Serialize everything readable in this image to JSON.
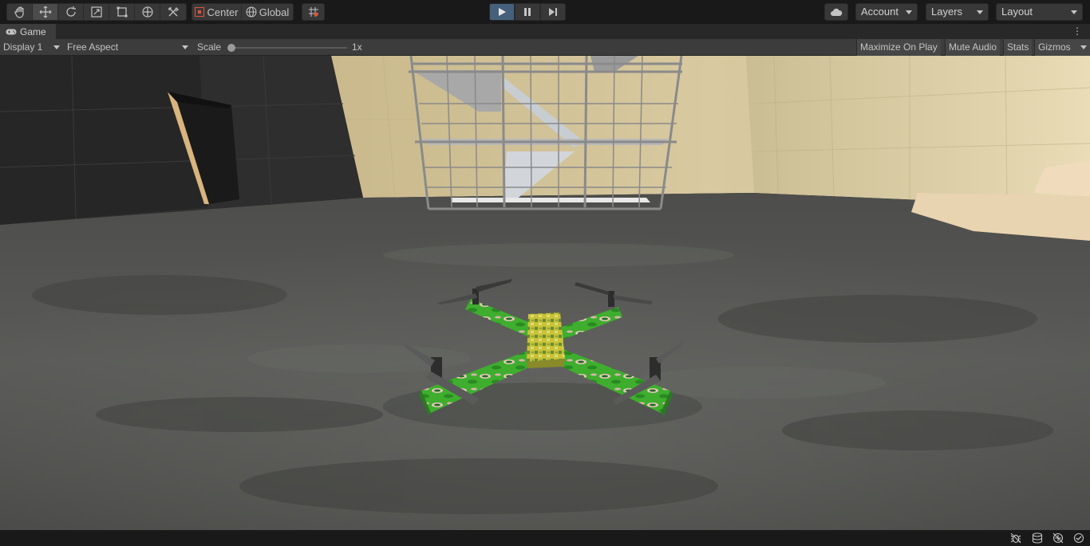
{
  "toolbar": {
    "tools": [
      {
        "name": "hand-tool-icon"
      },
      {
        "name": "move-tool-icon",
        "active": true
      },
      {
        "name": "rotate-tool-icon"
      },
      {
        "name": "scale-tool-icon"
      },
      {
        "name": "rect-tool-icon"
      },
      {
        "name": "transform-tool-icon"
      },
      {
        "name": "custom-tools-icon"
      }
    ],
    "pivot_mode": "Center",
    "pivot_rotation": "Global",
    "grid_snap_icon": "grid-snap-icon",
    "play_controls": {
      "play_active": true
    },
    "account_label": "Account",
    "layers_label": "Layers",
    "layout_label": "Layout"
  },
  "tab": {
    "label": "Game",
    "icon": "gamepad-icon"
  },
  "gamebar": {
    "display": "Display 1",
    "aspect": "Free Aspect",
    "scale_label": "Scale",
    "scale_value": "1x",
    "scale_level": 0,
    "maximize_on_play": "Maximize On Play",
    "mute_audio": "Mute Audio",
    "stats": "Stats",
    "gizmos": "Gizmos"
  },
  "statusbar": {
    "icons": [
      "debug-icon",
      "cache-server-icon",
      "auto-generate-lighting-icon",
      "collab-status-icon"
    ]
  },
  "colors": {
    "toolbar_bg": "#191919",
    "panel_bg": "#3c3c3c",
    "play_active": "#46607c",
    "drone_green": "#3fae2e",
    "drone_yellow": "#c8c23a"
  }
}
